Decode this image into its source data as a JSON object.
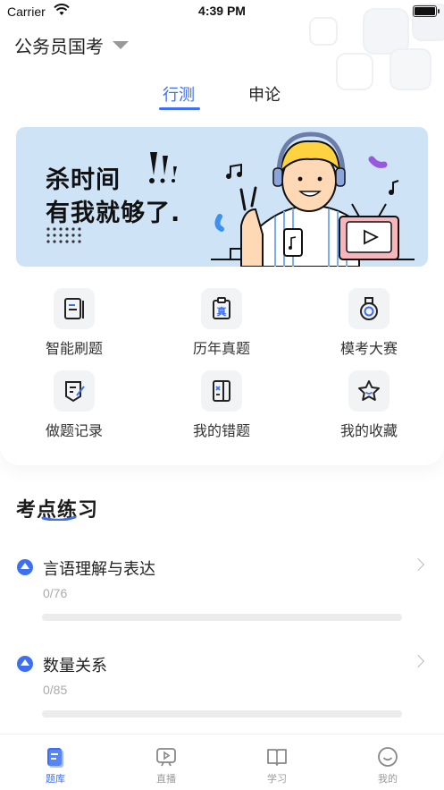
{
  "status_bar": {
    "carrier": "Carrier",
    "time": "4:39 PM"
  },
  "header": {
    "exam_name": "公务员国考"
  },
  "tabs": [
    {
      "label": "行测",
      "active": true
    },
    {
      "label": "申论",
      "active": false
    }
  ],
  "banner": {
    "line1": "杀时间",
    "line2": "有我就够了."
  },
  "features": [
    {
      "label": "智能刷题",
      "icon": "smart-practice-icon"
    },
    {
      "label": "历年真题",
      "icon": "past-papers-icon"
    },
    {
      "label": "模考大赛",
      "icon": "mock-exam-medal-icon"
    },
    {
      "label": "做题记录",
      "icon": "practice-record-icon"
    },
    {
      "label": "我的错题",
      "icon": "wrong-questions-icon"
    },
    {
      "label": "我的收藏",
      "icon": "favorites-star-icon"
    }
  ],
  "practice": {
    "title": "考点练习",
    "items": [
      {
        "name": "言语理解与表达",
        "count": "0/76",
        "progress": 0
      },
      {
        "name": "数量关系",
        "count": "0/85",
        "progress": 0
      }
    ]
  },
  "tabbar": [
    {
      "label": "题库",
      "icon": "question-bank-icon",
      "active": true
    },
    {
      "label": "直播",
      "icon": "live-tv-icon",
      "active": false
    },
    {
      "label": "学习",
      "icon": "study-book-icon",
      "active": false
    },
    {
      "label": "我的",
      "icon": "profile-smile-icon",
      "active": false
    }
  ],
  "colors": {
    "accent": "#3d6ff0",
    "banner_bg": "#cfe3f7"
  }
}
